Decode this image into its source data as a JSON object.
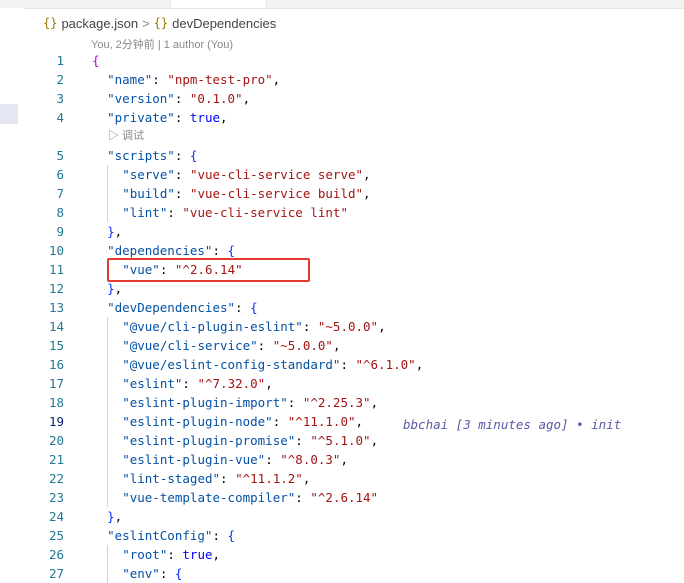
{
  "breadcrumb": {
    "file": "package.json",
    "section": "devDependencies",
    "brace_glyph": "{}",
    "sep": ">"
  },
  "codelens": {
    "author": "You, 2分钟前 | 1 author (You)",
    "debug": "▷ 调试"
  },
  "blame": "bbchai [3 minutes ago] • init",
  "active_line": 19,
  "lines": [
    {
      "n": "1",
      "t": "{"
    },
    {
      "n": "2",
      "t": "\"name\": \"npm-test-pro\","
    },
    {
      "n": "3",
      "t": "\"version\": \"0.1.0\","
    },
    {
      "n": "4",
      "t": "\"private\": true,"
    },
    {
      "n": "5",
      "t": "\"scripts\": {"
    },
    {
      "n": "6",
      "t": "\"serve\": \"vue-cli-service serve\","
    },
    {
      "n": "7",
      "t": "\"build\": \"vue-cli-service build\","
    },
    {
      "n": "8",
      "t": "\"lint\": \"vue-cli-service lint\""
    },
    {
      "n": "9",
      "t": "},"
    },
    {
      "n": "10",
      "t": "\"dependencies\": {"
    },
    {
      "n": "11",
      "t": "\"vue\": \"^2.6.14\""
    },
    {
      "n": "12",
      "t": "},"
    },
    {
      "n": "13",
      "t": "\"devDependencies\": {"
    },
    {
      "n": "14",
      "t": "\"@vue/cli-plugin-eslint\": \"~5.0.0\","
    },
    {
      "n": "15",
      "t": "\"@vue/cli-service\": \"~5.0.0\","
    },
    {
      "n": "16",
      "t": "\"@vue/eslint-config-standard\": \"^6.1.0\","
    },
    {
      "n": "17",
      "t": "\"eslint\": \"^7.32.0\","
    },
    {
      "n": "18",
      "t": "\"eslint-plugin-import\": \"^2.25.3\","
    },
    {
      "n": "19",
      "t": "\"eslint-plugin-node\": \"^11.1.0\","
    },
    {
      "n": "20",
      "t": "\"eslint-plugin-promise\": \"^5.1.0\","
    },
    {
      "n": "21",
      "t": "\"eslint-plugin-vue\": \"^8.0.3\","
    },
    {
      "n": "22",
      "t": "\"lint-staged\": \"^11.1.2\","
    },
    {
      "n": "23",
      "t": "\"vue-template-compiler\": \"^2.6.14\""
    },
    {
      "n": "24",
      "t": "},"
    },
    {
      "n": "25",
      "t": "\"eslintConfig\": {"
    },
    {
      "n": "26",
      "t": "\"root\": true,"
    },
    {
      "n": "27",
      "t": "\"env\": {"
    }
  ],
  "colors": {
    "key": "#0451a5",
    "string": "#a31515",
    "boolean": "#0000ff",
    "line_number": "#237893",
    "active_line_number": "#0b216f",
    "highlight_box": "#e23a2d",
    "blame": "#5a5aa5"
  }
}
